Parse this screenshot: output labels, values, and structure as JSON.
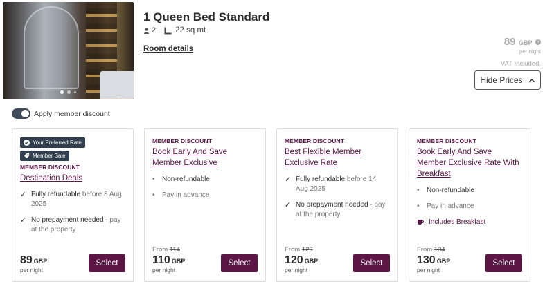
{
  "room": {
    "title": "1 Queen Bed Standard",
    "guests": "2",
    "size": "22 sq mt",
    "details_link": "Room details"
  },
  "top_price": {
    "amount": "89",
    "currency": "GBP",
    "per_night": "per night",
    "vat": "VAT Included."
  },
  "hide_prices_label": "Hide Prices",
  "member_toggle": {
    "label": "Apply member discount",
    "on": true
  },
  "cards": [
    {
      "badges": [
        "Your Preferred Rate",
        "Member Sale"
      ],
      "member_label": "MEMBER DISCOUNT",
      "rate_name": "Destination Deals",
      "features": [
        {
          "strong": "Fully refundable",
          "muted": " before 8 Aug 2025"
        },
        {
          "strong": "No prepayment needed",
          "muted": " - pay at the property"
        }
      ],
      "price": "89",
      "currency": "GBP",
      "per_night": "per night",
      "select_label": "Select"
    },
    {
      "member_label": "MEMBER DISCOUNT",
      "rate_name": "Book Early And Save Member Exclusive",
      "bullets": [
        "Non-refundable",
        "Pay in advance"
      ],
      "from_label": "From",
      "old_price": "114",
      "price": "110",
      "currency": "GBP",
      "per_night": "per night",
      "select_label": "Select"
    },
    {
      "member_label": "MEMBER DISCOUNT",
      "rate_name": "Best Flexible Member Exclusive Rate",
      "features": [
        {
          "strong": "Fully refundable",
          "muted": " before 14 Aug 2025"
        },
        {
          "strong": "No prepayment needed",
          "muted": " - pay at the property"
        }
      ],
      "from_label": "From",
      "old_price": "126",
      "price": "120",
      "currency": "GBP",
      "per_night": "per night",
      "select_label": "Select"
    },
    {
      "member_label": "MEMBER DISCOUNT",
      "rate_name": "Book Early And Save Member Exclusive Rate With Breakfast",
      "bullets": [
        "Non-refundable",
        "Pay in advance"
      ],
      "breakfast": "Includes Breakfast",
      "from_label": "From",
      "old_price": "134",
      "price": "130",
      "currency": "GBP",
      "per_night": "per night",
      "select_label": "Select"
    }
  ],
  "colors": {
    "brand": "#5b1646",
    "badge": "#2f3d4c",
    "toggle": "#3f4a5a"
  }
}
